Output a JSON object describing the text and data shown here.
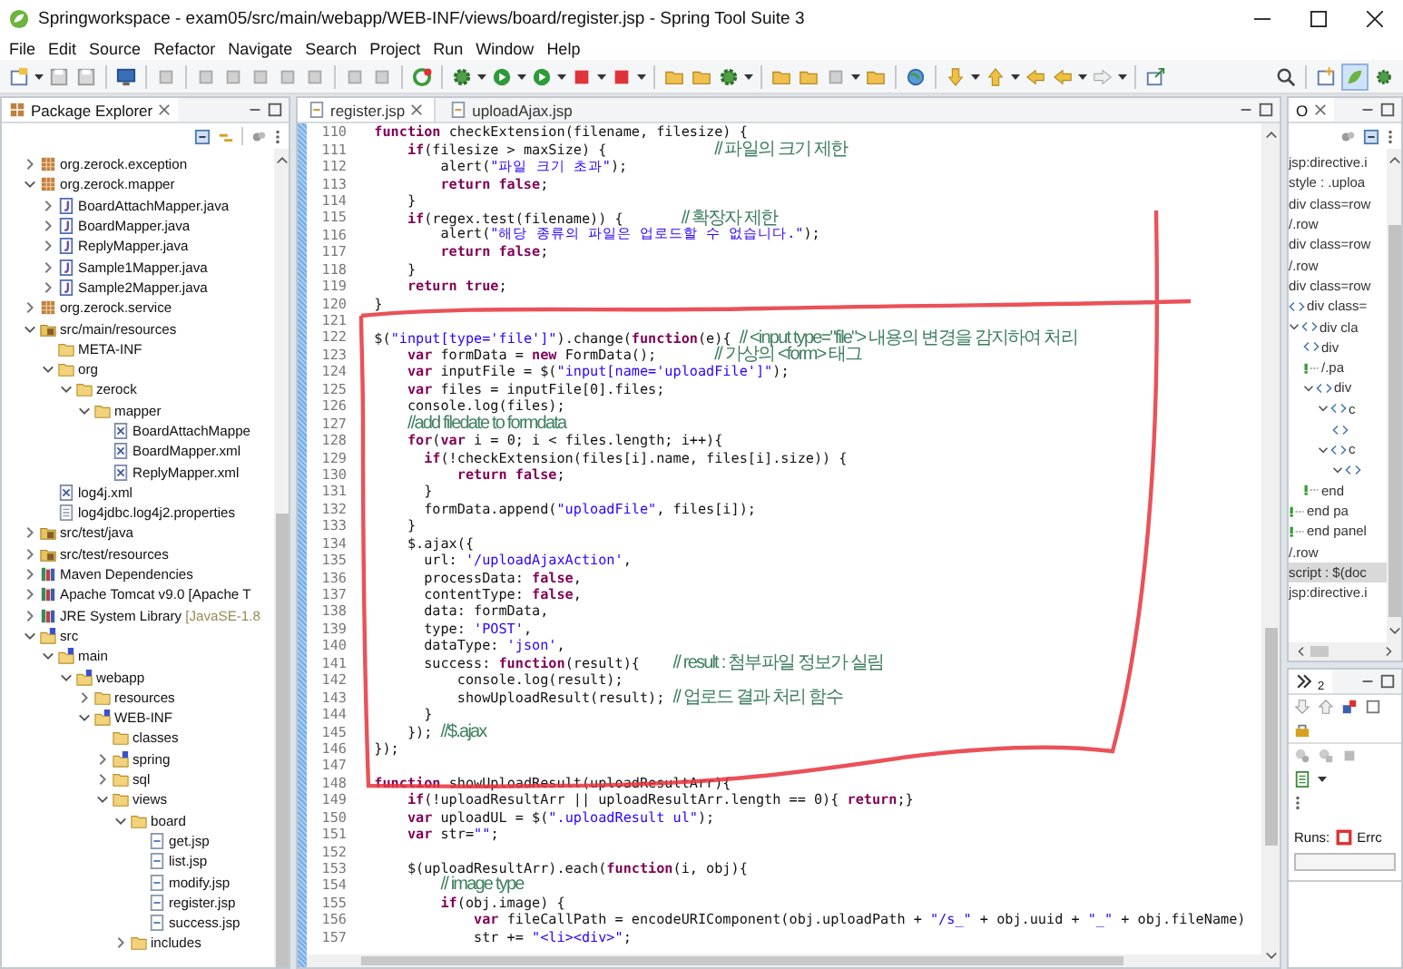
{
  "window": {
    "title": "Springworkspace - exam05/src/main/webapp/WEB-INF/views/board/register.jsp - Spring Tool Suite 3"
  },
  "menu": [
    "File",
    "Edit",
    "Source",
    "Refactor",
    "Navigate",
    "Search",
    "Project",
    "Run",
    "Window",
    "Help"
  ],
  "explorer": {
    "title": "Package Explorer",
    "items": [
      {
        "label": "org.zerock.exception",
        "kind": "package",
        "expanded": false
      },
      {
        "label": "org.zerock.mapper",
        "kind": "package",
        "expanded": true,
        "children": [
          {
            "label": "BoardAttachMapper.java",
            "kind": "java",
            "expanded": false
          },
          {
            "label": "BoardMapper.java",
            "kind": "java",
            "expanded": false
          },
          {
            "label": "ReplyMapper.java",
            "kind": "java",
            "expanded": false
          },
          {
            "label": "Sample1Mapper.java",
            "kind": "java",
            "expanded": false
          },
          {
            "label": "Sample2Mapper.java",
            "kind": "java",
            "expanded": false
          }
        ]
      },
      {
        "label": "org.zerock.service",
        "kind": "package",
        "expanded": false
      },
      {
        "label": "src/main/resources",
        "kind": "srcfolder",
        "expanded": true,
        "children": [
          {
            "label": "META-INF",
            "kind": "folder"
          },
          {
            "label": "org",
            "kind": "folder",
            "expanded": true,
            "children": [
              {
                "label": "zerock",
                "kind": "folder",
                "expanded": true,
                "children": [
                  {
                    "label": "mapper",
                    "kind": "folder",
                    "expanded": true,
                    "children": [
                      {
                        "label": "BoardAttachMappe",
                        "kind": "xml"
                      },
                      {
                        "label": "BoardMapper.xml",
                        "kind": "xml"
                      },
                      {
                        "label": "ReplyMapper.xml",
                        "kind": "xml"
                      }
                    ]
                  }
                ]
              }
            ]
          },
          {
            "label": "log4j.xml",
            "kind": "xml"
          },
          {
            "label": "log4jdbc.log4j2.properties",
            "kind": "props"
          }
        ]
      },
      {
        "label": "src/test/java",
        "kind": "srcfolder",
        "expanded": false
      },
      {
        "label": "src/test/resources",
        "kind": "srcfolder",
        "expanded": false
      },
      {
        "label": "Maven Dependencies",
        "kind": "library",
        "expanded": false
      },
      {
        "label": "Apache Tomcat v9.0 [Apache T",
        "kind": "library",
        "expanded": false
      },
      {
        "label": "JRE System Library",
        "decoration": "[JavaSE-1.8",
        "kind": "library",
        "expanded": false
      },
      {
        "label": "src",
        "kind": "webfolder",
        "expanded": true,
        "children": [
          {
            "label": "main",
            "kind": "webfolder",
            "expanded": true,
            "children": [
              {
                "label": "webapp",
                "kind": "webfolder",
                "expanded": true,
                "children": [
                  {
                    "label": "resources",
                    "kind": "folder",
                    "expanded": false
                  },
                  {
                    "label": "WEB-INF",
                    "kind": "webfolder",
                    "expanded": true,
                    "children": [
                      {
                        "label": "classes",
                        "kind": "folder"
                      },
                      {
                        "label": "spring",
                        "kind": "webfolder",
                        "expanded": false
                      },
                      {
                        "label": "sql",
                        "kind": "folder",
                        "expanded": false
                      },
                      {
                        "label": "views",
                        "kind": "folder",
                        "expanded": true,
                        "children": [
                          {
                            "label": "board",
                            "kind": "folder",
                            "expanded": true,
                            "children": [
                              {
                                "label": "get.jsp",
                                "kind": "jsp"
                              },
                              {
                                "label": "list.jsp",
                                "kind": "jsp"
                              },
                              {
                                "label": "modify.jsp",
                                "kind": "jsp"
                              },
                              {
                                "label": "register.jsp",
                                "kind": "jsp"
                              },
                              {
                                "label": "success.jsp",
                                "kind": "jsp"
                              }
                            ]
                          },
                          {
                            "label": "includes",
                            "kind": "folder",
                            "expanded": false
                          }
                        ]
                      }
                    ]
                  }
                ]
              }
            ]
          }
        ]
      }
    ]
  },
  "editor": {
    "tabs": [
      {
        "label": "register.jsp",
        "selected": true
      },
      {
        "label": "uploadAjax.jsp",
        "selected": false
      }
    ],
    "lines": [
      {
        "num": "110",
        "segments": [
          {
            "kind": "keyword",
            "text": "  function"
          },
          {
            "kind": "plain",
            "text": " checkExtension(filename, filesize) {"
          }
        ]
      },
      {
        "num": "111",
        "segments": [
          {
            "kind": "keyword",
            "text": "      if"
          },
          {
            "kind": "plain",
            "text": "(filesize > maxSize) {             "
          },
          {
            "kind": "comment",
            "text": "// 파일의 크기 제한"
          }
        ]
      },
      {
        "num": "112",
        "segments": [
          {
            "kind": "plain",
            "text": "          alert("
          },
          {
            "kind": "string",
            "text": "\"파일 크기 초과\""
          },
          {
            "kind": "plain",
            "text": ");"
          }
        ]
      },
      {
        "num": "113",
        "segments": [
          {
            "kind": "keyword",
            "text": "          return false"
          },
          {
            "kind": "plain",
            "text": ";"
          }
        ]
      },
      {
        "num": "114",
        "segments": [
          {
            "kind": "plain",
            "text": "      }"
          }
        ]
      },
      {
        "num": "115",
        "segments": [
          {
            "kind": "keyword",
            "text": "      if"
          },
          {
            "kind": "plain",
            "text": "(regex.test(filename)) {       "
          },
          {
            "kind": "comment",
            "text": "// 확장자 제한"
          }
        ]
      },
      {
        "num": "116",
        "segments": [
          {
            "kind": "plain",
            "text": "          alert("
          },
          {
            "kind": "string",
            "text": "\"해당 종류의 파일은 업로드할 수 없습니다.\""
          },
          {
            "kind": "plain",
            "text": ");"
          }
        ]
      },
      {
        "num": "117",
        "segments": [
          {
            "kind": "keyword",
            "text": "          return false"
          },
          {
            "kind": "plain",
            "text": ";"
          }
        ]
      },
      {
        "num": "118",
        "segments": [
          {
            "kind": "plain",
            "text": "      }"
          }
        ]
      },
      {
        "num": "119",
        "segments": [
          {
            "kind": "keyword",
            "text": "      return true"
          },
          {
            "kind": "plain",
            "text": ";"
          }
        ]
      },
      {
        "num": "120",
        "segments": [
          {
            "kind": "plain",
            "text": "  }"
          }
        ]
      },
      {
        "num": "121"
      },
      {
        "num": "122",
        "segments": [
          {
            "kind": "plain",
            "text": "  $("
          },
          {
            "kind": "string",
            "text": "\"input[type='file']\""
          },
          {
            "kind": "plain",
            "text": ").change("
          },
          {
            "kind": "keyword",
            "text": "function"
          },
          {
            "kind": "plain",
            "text": "(e){ "
          },
          {
            "kind": "comment",
            "text": "// <input type=\"file\"> 내용의 변경을 감지하여 처리"
          }
        ]
      },
      {
        "num": "123",
        "segments": [
          {
            "kind": "keyword",
            "text": "      var"
          },
          {
            "kind": "plain",
            "text": " formData = "
          },
          {
            "kind": "keyword",
            "text": "new"
          },
          {
            "kind": "plain",
            "text": " FormData();       "
          },
          {
            "kind": "comment",
            "text": "// 가상의 <form> 태그"
          }
        ]
      },
      {
        "num": "124",
        "segments": [
          {
            "kind": "keyword",
            "text": "      var"
          },
          {
            "kind": "plain",
            "text": " inputFile = $("
          },
          {
            "kind": "string",
            "text": "\"input[name='uploadFile']\""
          },
          {
            "kind": "plain",
            "text": ");"
          }
        ]
      },
      {
        "num": "125",
        "segments": [
          {
            "kind": "keyword",
            "text": "      var"
          },
          {
            "kind": "plain",
            "text": " files = inputFile[0].files;"
          }
        ]
      },
      {
        "num": "126",
        "segments": [
          {
            "kind": "plain",
            "text": "      console.log(files);"
          }
        ]
      },
      {
        "num": "127",
        "segments": [
          {
            "kind": "comment",
            "text": "      //add filedate to formdata"
          }
        ]
      },
      {
        "num": "128",
        "segments": [
          {
            "kind": "keyword",
            "text": "      for"
          },
          {
            "kind": "plain",
            "text": "("
          },
          {
            "kind": "keyword",
            "text": "var"
          },
          {
            "kind": "plain",
            "text": " i = 0; i < files.length; i++){"
          }
        ]
      },
      {
        "num": "129",
        "segments": [
          {
            "kind": "keyword",
            "text": "        if"
          },
          {
            "kind": "plain",
            "text": "(!checkExtension(files[i].name, files[i].size)) {"
          }
        ]
      },
      {
        "num": "130",
        "segments": [
          {
            "kind": "keyword",
            "text": "            return false"
          },
          {
            "kind": "plain",
            "text": ";"
          }
        ]
      },
      {
        "num": "131",
        "segments": [
          {
            "kind": "plain",
            "text": "        }"
          }
        ]
      },
      {
        "num": "132",
        "segments": [
          {
            "kind": "plain",
            "text": "        formData.append("
          },
          {
            "kind": "string",
            "text": "\"uploadFile\""
          },
          {
            "kind": "plain",
            "text": ", files[i]);"
          }
        ]
      },
      {
        "num": "133",
        "segments": [
          {
            "kind": "plain",
            "text": "      }"
          }
        ]
      },
      {
        "num": "134",
        "segments": [
          {
            "kind": "plain",
            "text": "      $.ajax({"
          }
        ]
      },
      {
        "num": "135",
        "segments": [
          {
            "kind": "plain",
            "text": "        url: "
          },
          {
            "kind": "string",
            "text": "'/uploadAjaxAction'"
          },
          {
            "kind": "plain",
            "text": ","
          }
        ]
      },
      {
        "num": "136",
        "segments": [
          {
            "kind": "plain",
            "text": "        processData: "
          },
          {
            "kind": "keyword",
            "text": "false"
          },
          {
            "kind": "plain",
            "text": ","
          }
        ]
      },
      {
        "num": "137",
        "segments": [
          {
            "kind": "plain",
            "text": "        contentType: "
          },
          {
            "kind": "keyword",
            "text": "false"
          },
          {
            "kind": "plain",
            "text": ","
          }
        ]
      },
      {
        "num": "138",
        "segments": [
          {
            "kind": "plain",
            "text": "        data: formData,"
          }
        ]
      },
      {
        "num": "139",
        "segments": [
          {
            "kind": "plain",
            "text": "        type: "
          },
          {
            "kind": "string",
            "text": "'POST'"
          },
          {
            "kind": "plain",
            "text": ","
          }
        ]
      },
      {
        "num": "140",
        "segments": [
          {
            "kind": "plain",
            "text": "        dataType: "
          },
          {
            "kind": "string",
            "text": "'json'"
          },
          {
            "kind": "plain",
            "text": ","
          }
        ]
      },
      {
        "num": "141",
        "segments": [
          {
            "kind": "plain",
            "text": "        success: "
          },
          {
            "kind": "keyword",
            "text": "function"
          },
          {
            "kind": "plain",
            "text": "(result){    "
          },
          {
            "kind": "comment",
            "text": "// result : 첨부파일 정보가 실림"
          }
        ]
      },
      {
        "num": "142",
        "segments": [
          {
            "kind": "plain",
            "text": "            console.log(result);"
          }
        ]
      },
      {
        "num": "143",
        "segments": [
          {
            "kind": "plain",
            "text": "            showUploadResult(result); "
          },
          {
            "kind": "comment",
            "text": "// 업로드 결과 처리 함수"
          }
        ]
      },
      {
        "num": "144",
        "segments": [
          {
            "kind": "plain",
            "text": "        }"
          }
        ]
      },
      {
        "num": "145",
        "segments": [
          {
            "kind": "plain",
            "text": "      }); "
          },
          {
            "kind": "comment",
            "text": "//$.ajax"
          }
        ]
      },
      {
        "num": "146",
        "segments": [
          {
            "kind": "plain",
            "text": "  });"
          }
        ]
      },
      {
        "num": "147"
      },
      {
        "num": "148",
        "segments": [
          {
            "kind": "keyword",
            "text": "  function"
          },
          {
            "kind": "plain",
            "text": " showUploadResult(uploadResultArr){"
          }
        ]
      },
      {
        "num": "149",
        "segments": [
          {
            "kind": "keyword",
            "text": "      if"
          },
          {
            "kind": "plain",
            "text": "(!uploadResultArr || uploadResultArr.length == 0){ "
          },
          {
            "kind": "keyword",
            "text": "return"
          },
          {
            "kind": "plain",
            "text": ";}"
          }
        ]
      },
      {
        "num": "150",
        "segments": [
          {
            "kind": "keyword",
            "text": "      var"
          },
          {
            "kind": "plain",
            "text": " uploadUL = $("
          },
          {
            "kind": "string",
            "text": "\".uploadResult ul\""
          },
          {
            "kind": "plain",
            "text": ");"
          }
        ]
      },
      {
        "num": "151",
        "segments": [
          {
            "kind": "keyword",
            "text": "      var"
          },
          {
            "kind": "plain",
            "text": " str="
          },
          {
            "kind": "string",
            "text": "\"\""
          },
          {
            "kind": "plain",
            "text": ";"
          }
        ]
      },
      {
        "num": "152"
      },
      {
        "num": "153",
        "segments": [
          {
            "kind": "plain",
            "text": "      $(uploadResultArr).each("
          },
          {
            "kind": "keyword",
            "text": "function"
          },
          {
            "kind": "plain",
            "text": "(i, obj){"
          }
        ]
      },
      {
        "num": "154",
        "segments": [
          {
            "kind": "comment",
            "text": "          // image type"
          }
        ]
      },
      {
        "num": "155",
        "segments": [
          {
            "kind": "keyword",
            "text": "          if"
          },
          {
            "kind": "plain",
            "text": "(obj.image) {"
          }
        ]
      },
      {
        "num": "156",
        "segments": [
          {
            "kind": "keyword",
            "text": "              var"
          },
          {
            "kind": "plain",
            "text": " fileCallPath = encodeURIComponent(obj.uploadPath + "
          },
          {
            "kind": "string",
            "text": "\"/s_\""
          },
          {
            "kind": "plain",
            "text": " + obj.uuid + "
          },
          {
            "kind": "string",
            "text": "\"_\""
          },
          {
            "kind": "plain",
            "text": " + obj.fileName)"
          }
        ]
      },
      {
        "num": "157",
        "segments": [
          {
            "kind": "plain",
            "text": "              str += "
          },
          {
            "kind": "string",
            "text": "\"<li><div>\""
          },
          {
            "kind": "plain",
            "text": ";"
          }
        ]
      }
    ]
  },
  "outline": {
    "title": "O",
    "items": [
      {
        "label": "jsp:directive.i",
        "selected": false
      },
      {
        "label": "style : .uploa",
        "selected": false
      },
      {
        "label": "div class=row",
        "selected": false
      },
      {
        "label": "/.row",
        "selected": false
      },
      {
        "label": "div class=row",
        "selected": false
      },
      {
        "label": "/.row",
        "selected": false
      },
      {
        "label": "div class=row",
        "selected": false
      },
      {
        "label": "div class=",
        "kind": "tag",
        "selected": false
      },
      {
        "label": "div cla",
        "kind": "tag",
        "expanded": true,
        "selected": false,
        "children": [
          {
            "label": "div",
            "kind": "tag",
            "selected": false
          },
          {
            "label": "/.pa",
            "kind": "comment",
            "selected": false
          },
          {
            "label": "div",
            "kind": "tag",
            "expanded": true,
            "selected": false,
            "children": [
              {
                "label": "c",
                "kind": "tag",
                "expanded": true,
                "selected": false,
                "children": [
                  {
                    "kind": "tag",
                    "selected": false
                  }
                ]
              },
              {
                "label": "c",
                "kind": "tag",
                "expanded": true,
                "selected": false,
                "children": [
                  {
                    "kind": "tag",
                    "expanded": true,
                    "selected": false
                  }
                ]
              }
            ]
          },
          {
            "label": "end",
            "kind": "comment",
            "selected": false
          }
        ]
      },
      {
        "label": "end pa",
        "kind": "comment",
        "selected": false
      },
      {
        "label": "end panel",
        "kind": "comment",
        "selected": false
      },
      {
        "label": "/.row",
        "selected": false
      },
      {
        "label": "script : $(doc",
        "selected": true
      },
      {
        "label": "jsp:directive.i",
        "selected": false
      }
    ]
  },
  "junit": {
    "overflow_count": "2",
    "runs_label": "Runs:",
    "errors_label": "Errc",
    "progress": {
      "level": 0
    }
  }
}
